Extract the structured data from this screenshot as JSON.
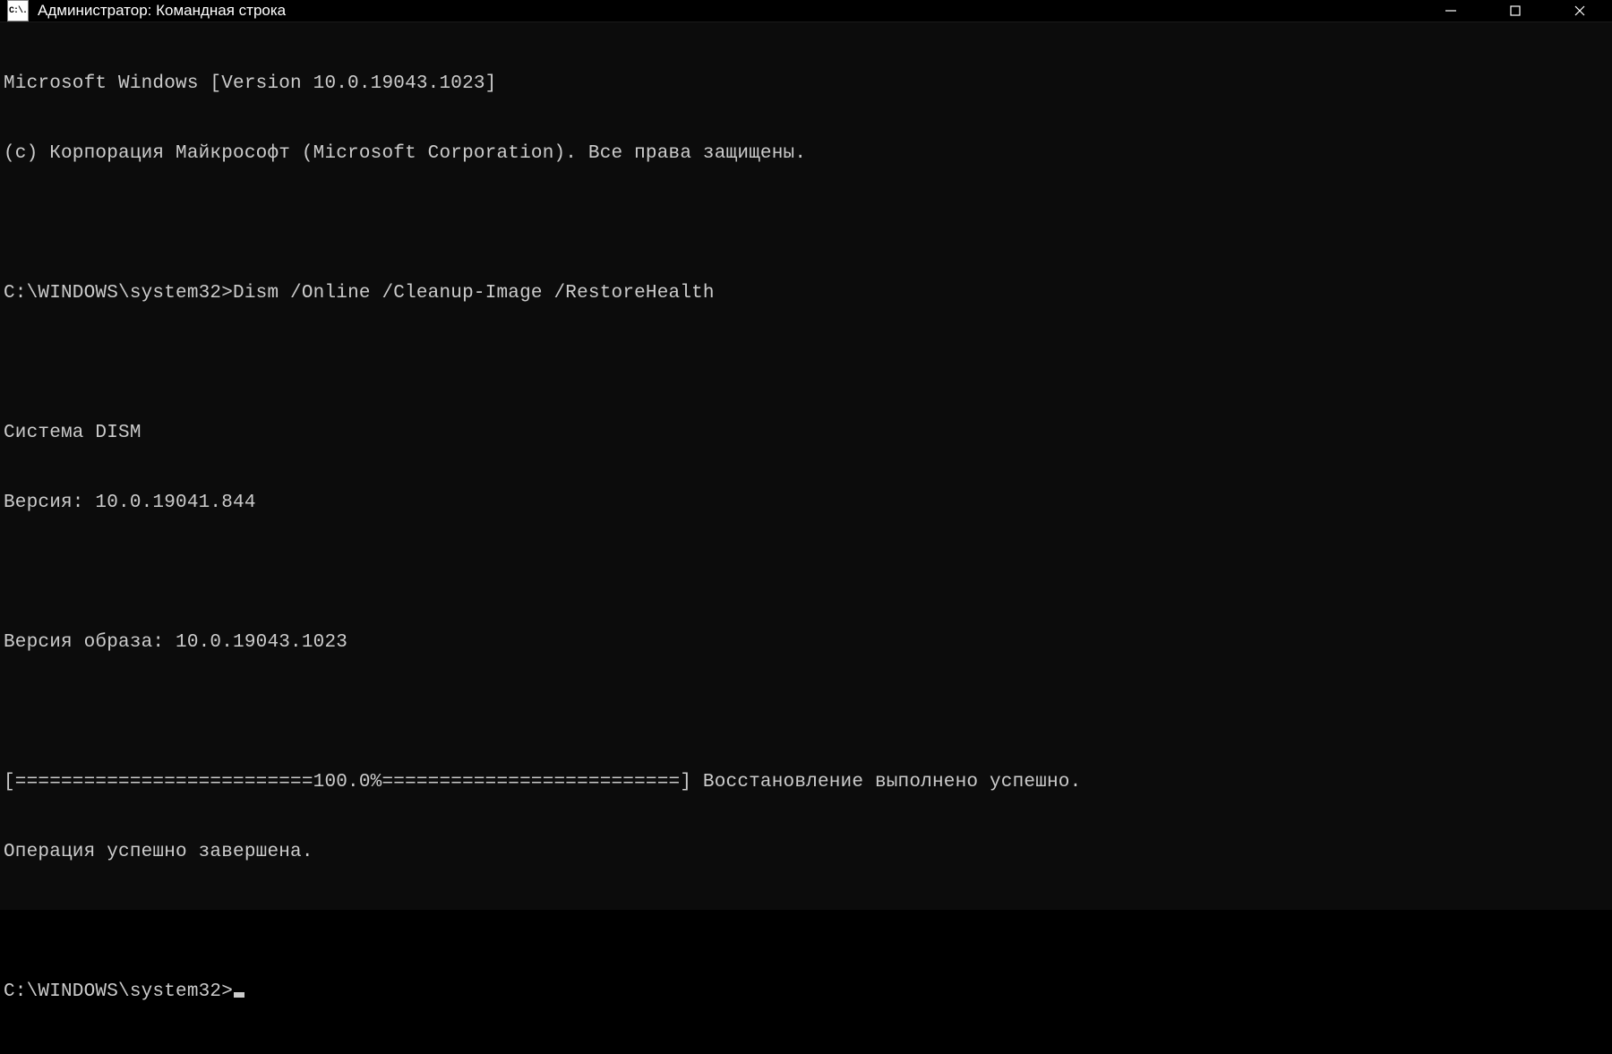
{
  "window": {
    "title": "Администратор: Командная строка",
    "icon_label": "C:\\."
  },
  "terminal": {
    "header_line1": "Microsoft Windows [Version 10.0.19043.1023]",
    "header_line2": "(c) Корпорация Майкрософт (Microsoft Corporation). Все права защищены.",
    "prompt1": "C:\\WINDOWS\\system32>",
    "command1": "Dism /Online /Cleanup-Image /RestoreHealth",
    "dism_title": "Cистема DISM",
    "dism_version": "Версия: 10.0.19041.844",
    "image_version": "Версия образа: 10.0.19043.1023",
    "progress_line": "[==========================100.0%==========================] Восстановление выполнено успешно.",
    "operation_complete": "Операция успешно завершена.",
    "prompt2": "C:\\WINDOWS\\system32>"
  }
}
